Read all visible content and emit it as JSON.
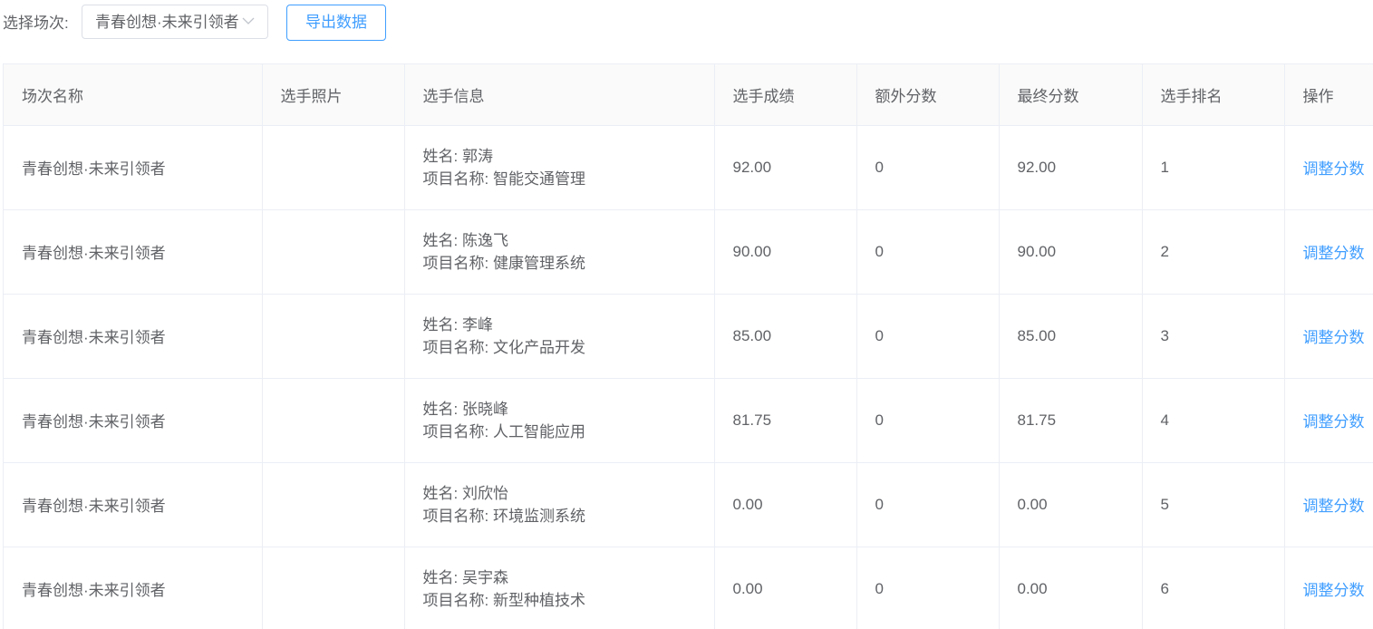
{
  "filter": {
    "label": "选择场次:",
    "selected": "青春创想·未来引领者",
    "chevron_icon": "chevron-down-icon"
  },
  "toolbar": {
    "export_label": "导出数据"
  },
  "colors": {
    "accent": "#409eff",
    "text": "#606266",
    "border": "#ebeef5",
    "header_bg": "#fafafa"
  },
  "table": {
    "columns": [
      "场次名称",
      "选手照片",
      "选手信息",
      "选手成绩",
      "额外分数",
      "最终分数",
      "选手排名",
      "操作"
    ],
    "rows": [
      {
        "session": "青春创想·未来引领者",
        "name": "姓名: 郭涛",
        "project": "项目名称: 智能交通管理",
        "score": "92.00",
        "extra": "0",
        "final": "92.00",
        "rank": "1",
        "action": "调整分数"
      },
      {
        "session": "青春创想·未来引领者",
        "name": "姓名: 陈逸飞",
        "project": "项目名称: 健康管理系统",
        "score": "90.00",
        "extra": "0",
        "final": "90.00",
        "rank": "2",
        "action": "调整分数"
      },
      {
        "session": "青春创想·未来引领者",
        "name": "姓名: 李峰",
        "project": "项目名称: 文化产品开发",
        "score": "85.00",
        "extra": "0",
        "final": "85.00",
        "rank": "3",
        "action": "调整分数"
      },
      {
        "session": "青春创想·未来引领者",
        "name": "姓名: 张晓峰",
        "project": "项目名称: 人工智能应用",
        "score": "81.75",
        "extra": "0",
        "final": "81.75",
        "rank": "4",
        "action": "调整分数"
      },
      {
        "session": "青春创想·未来引领者",
        "name": "姓名: 刘欣怡",
        "project": "项目名称: 环境监测系统",
        "score": "0.00",
        "extra": "0",
        "final": "0.00",
        "rank": "5",
        "action": "调整分数"
      },
      {
        "session": "青春创想·未来引领者",
        "name": "姓名: 吴宇森",
        "project": "项目名称: 新型种植技术",
        "score": "0.00",
        "extra": "0",
        "final": "0.00",
        "rank": "6",
        "action": "调整分数"
      }
    ]
  }
}
